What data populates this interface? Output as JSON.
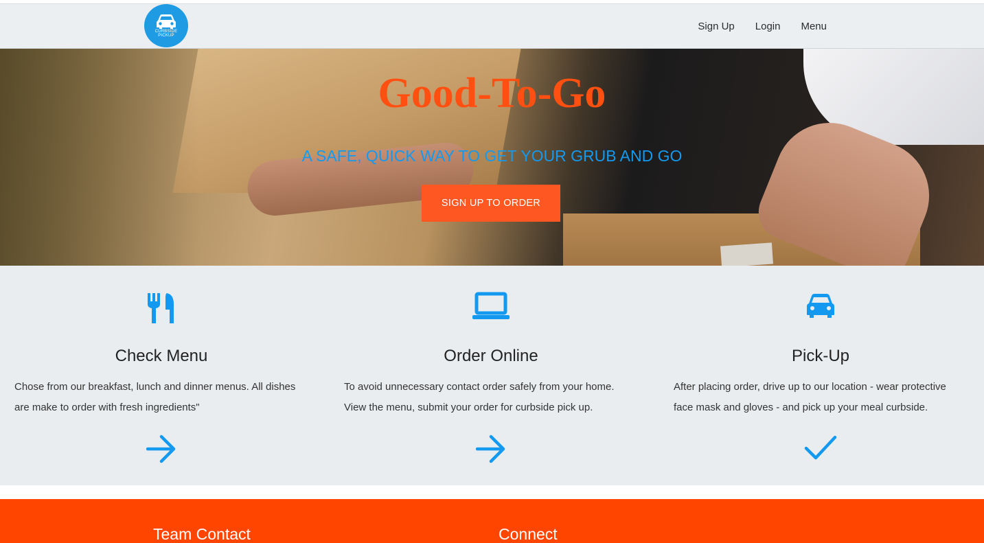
{
  "nav": {
    "logo_text_line1": "CURBSIDE",
    "logo_text_line2": "PICKUP",
    "links": [
      {
        "label": "Sign Up"
      },
      {
        "label": "Login"
      },
      {
        "label": "Menu"
      }
    ]
  },
  "hero": {
    "title": "Good-To-Go",
    "subtitle": "A SAFE, QUICK WAY TO GET YOUR GRUB AND GO",
    "cta_label": "SIGN UP TO ORDER"
  },
  "features": [
    {
      "icon": "fork-knife-icon",
      "title": "Check Menu",
      "text": "Chose from our breakfast, lunch and dinner menus. All dishes are make to order with fresh ingredients\"",
      "action_icon": "arrow-right-icon"
    },
    {
      "icon": "laptop-icon",
      "title": "Order Online",
      "text": "To avoid unnecessary contact order safely from your home. View the menu, submit your order for curbside pick up.",
      "action_icon": "arrow-right-icon"
    },
    {
      "icon": "car-icon",
      "title": "Pick-Up",
      "text": "After placing order, drive up to our location - wear protective face mask and gloves - and pick up your meal curbside.",
      "action_icon": "check-icon"
    }
  ],
  "footer": {
    "team_contact": "Team Contact",
    "connect": "Connect"
  },
  "colors": {
    "accent_orange": "#ff5722",
    "title_orange": "#ff5011",
    "accent_blue": "#139af0",
    "footer_orange": "#ff4500",
    "logo_blue": "#1e9be3"
  }
}
